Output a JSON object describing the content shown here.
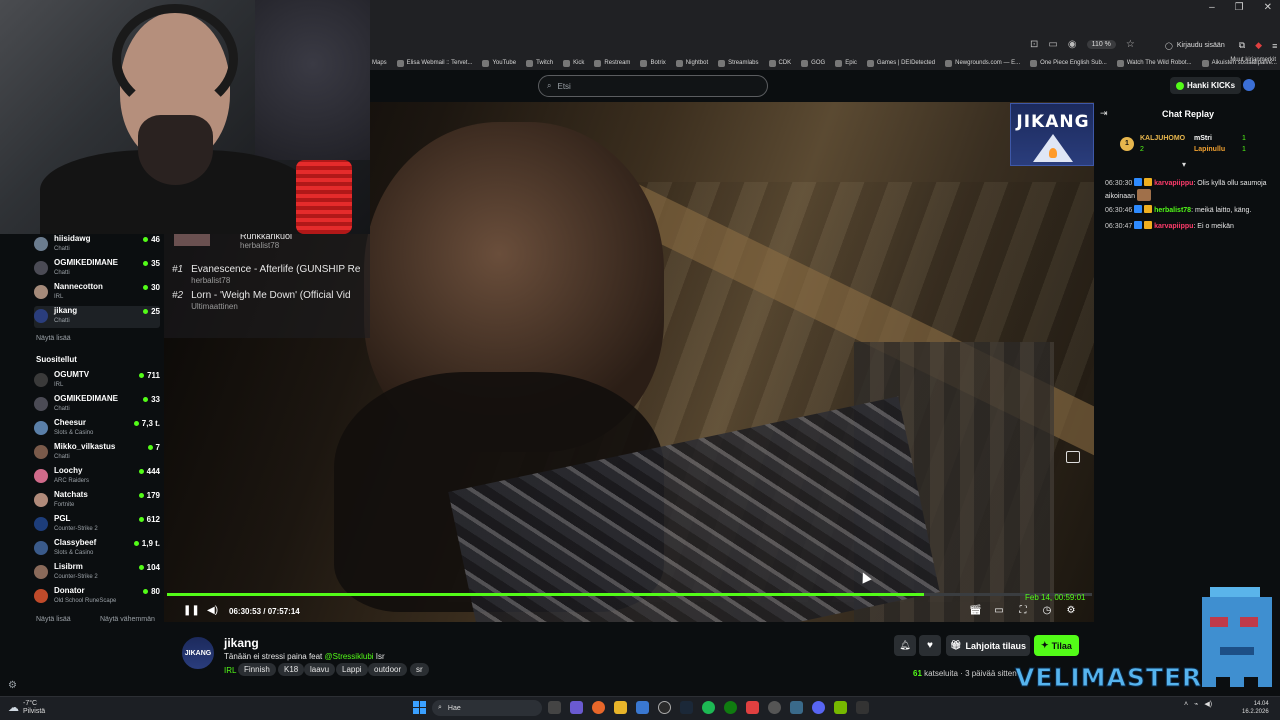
{
  "browser": {
    "zoom": "110 %",
    "login": "Kirjaudu sisään",
    "bookmarks": [
      "Maps",
      "Elisa Webmail :: Tervet...",
      "YouTube",
      "Twitch",
      "Kick",
      "Restream",
      "Botrix",
      "Nightbot",
      "Streamlabs",
      "CDK",
      "GOG",
      "Epic",
      "Games | DEIDetected",
      "Newgrounds.com — E...",
      "One Piece English Sub...",
      "Watch The Wild Robot...",
      "Aikuisten sosiaalipalve..."
    ],
    "other_bookmarks": "Muut kirjanmerkit"
  },
  "header": {
    "search_placeholder": "Etsi",
    "kicks_button": "Hanki KICKs"
  },
  "sidebar": {
    "following": [
      {
        "name": "hiisidawg",
        "category": "Chatti",
        "viewers": "46",
        "color": "#6b7c8f"
      },
      {
        "name": "OGMIKEDIMANE",
        "category": "Chatti",
        "viewers": "35",
        "color": "#4b4b55"
      },
      {
        "name": "Nannecotton",
        "category": "IRL",
        "viewers": "30",
        "color": "#a58a7a"
      },
      {
        "name": "jikang",
        "category": "Chatti",
        "viewers": "25",
        "color": "#2a3d7c"
      }
    ],
    "show_more": "Näytä lisää",
    "recommended_title": "Suositellut",
    "recommended": [
      {
        "name": "OGUMTV",
        "category": "IRL",
        "viewers": "711",
        "color": "#3a3a3a"
      },
      {
        "name": "OGMIKEDIMANE",
        "category": "Chatti",
        "viewers": "33",
        "color": "#4b4b55"
      },
      {
        "name": "Cheesur",
        "category": "Slots & Casino",
        "viewers": "7,3 t.",
        "color": "#5a7fa8"
      },
      {
        "name": "Mikko_vilkastus",
        "category": "Chatti",
        "viewers": "7",
        "color": "#7a5a4a"
      },
      {
        "name": "Loochy",
        "category": "ARC Raiders",
        "viewers": "444",
        "color": "#d06a8a"
      },
      {
        "name": "Natchats",
        "category": "Fortnite",
        "viewers": "179",
        "color": "#b08a7a"
      },
      {
        "name": "PGL",
        "category": "Counter-Strike 2",
        "viewers": "612",
        "color": "#1d3d7a"
      },
      {
        "name": "Classybeef",
        "category": "Slots & Casino",
        "viewers": "1,9 t.",
        "color": "#3a5a8a"
      },
      {
        "name": "Lisibrm",
        "category": "Counter-Strike 2",
        "viewers": "104",
        "color": "#8a6a5a"
      },
      {
        "name": "Donator",
        "category": "Old School RuneScape",
        "viewers": "80",
        "color": "#c04a2a"
      }
    ],
    "show_more_2": "Näytä lisää",
    "show_less": "Näytä vähemmän"
  },
  "queue": {
    "current_title": "Runkkarikuoi",
    "current_user": "herbalist78",
    "items": [
      {
        "num": "#1",
        "title": "Evanescence - Afterlife (GUNSHIP Re",
        "user": "herbalist78"
      },
      {
        "num": "#2",
        "title": "Lorn - 'Weigh Me Down' (Official Vid",
        "user": "Ultimaattinen"
      }
    ]
  },
  "player": {
    "logo_text": "JIKANG",
    "timestamp": "Feb 14, 00:59:01",
    "time": "06:30:53 / 07:57:14",
    "progress": 0.818
  },
  "channel": {
    "name": "jikang",
    "avatar_text": "JIKANG",
    "title_prefix": "Tänään ei stressi paina feat ",
    "title_mention": "@Stressiklubi",
    "title_suffix": " Isr",
    "category": "IRL",
    "tags": [
      "Finnish",
      "K18",
      "laavu",
      "Lappi",
      "outdoor",
      "sr"
    ],
    "gift_button": "Lahjoita tilaus",
    "subscribe_button": "Tilaa",
    "viewers_count": "61",
    "viewers_label": "katseluita",
    "started": "3 päivää sitten"
  },
  "chat": {
    "title": "Chat Replay",
    "gifters": [
      {
        "rank": "1",
        "name": "KALJUHOMO",
        "count": "2",
        "color": "#e7b64d"
      },
      {
        "rank": "",
        "name": "mStri",
        "count": "1",
        "color": "#ffffff"
      },
      {
        "rank": "",
        "name": "Lapinullu",
        "count": "1",
        "color": "#f0a030"
      }
    ],
    "messages": [
      {
        "time": "06:30:30",
        "user": "karvapiippu",
        "text": ": Olis kyllä ollu saumoja aikoinaan",
        "user_class": "u1"
      },
      {
        "time": "06:30:46",
        "user": "herbalist78",
        "text": ": meikä laitto, käng.",
        "user_class": "u2"
      },
      {
        "time": "06:30:47",
        "user": "karvapiippu",
        "text": ": Ei o meikän",
        "user_class": "u1"
      }
    ]
  },
  "watermark": "VELIMASTER",
  "taskbar": {
    "temp": "-7°C",
    "weather": "Pilvistä",
    "search": "Hae",
    "time": "14.04",
    "date": "16.2.2026"
  }
}
